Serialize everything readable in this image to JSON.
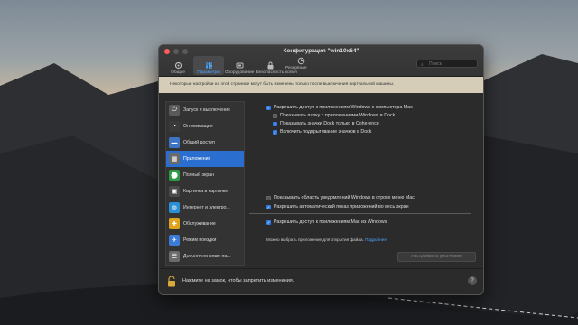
{
  "window": {
    "title": "Конфигурация \"win10x64\""
  },
  "toolbar": {
    "items": [
      {
        "label": "Общие",
        "icon": "gear-icon"
      },
      {
        "label": "Параметры",
        "icon": "sliders-icon"
      },
      {
        "label": "Оборудование",
        "icon": "hardware-icon"
      },
      {
        "label": "Безопасность",
        "icon": "lock-icon"
      },
      {
        "label": "Резервная копия",
        "icon": "clock-icon"
      }
    ],
    "active_index": 1,
    "search_placeholder": "Поиск"
  },
  "notice": "Некоторые настройки на этой странице могут быть изменены только после выключения виртуальной машины.",
  "sidebar": {
    "items": [
      {
        "label": "Запуск и выключение",
        "icon": "power-icon",
        "color": "#5a5a5c"
      },
      {
        "label": "Оптимизация",
        "icon": "speedometer-icon",
        "color": "#3a3a3c"
      },
      {
        "label": "Общий доступ",
        "icon": "folder-icon",
        "color": "#3d74c4"
      },
      {
        "label": "Приложения",
        "icon": "apps-icon",
        "color": "#6a6a6a"
      },
      {
        "label": "Полный экран",
        "icon": "fullscreen-icon",
        "color": "#2d9b45"
      },
      {
        "label": "Картинка в картинке",
        "icon": "pip-icon",
        "color": "#4a4a4c"
      },
      {
        "label": "Интернет и электро...",
        "icon": "globe-icon",
        "color": "#2b8fd6"
      },
      {
        "label": "Обслуживание",
        "icon": "maintenance-icon",
        "color": "#e0a21a"
      },
      {
        "label": "Режим поездки",
        "icon": "travel-icon",
        "color": "#3a7bd5"
      },
      {
        "label": "Дополнительные на...",
        "icon": "advanced-icon",
        "color": "#6a6a6c"
      }
    ],
    "active_index": 3
  },
  "options": [
    {
      "label": "Разрешить доступ к приложениям Windows с компьютера Mac",
      "checked": true,
      "indent": 0
    },
    {
      "label": "Показывать папку с приложениями Windows в Dock",
      "checked": false,
      "indent": 1
    },
    {
      "label": "Показывать значки Dock только в Coherence",
      "checked": true,
      "indent": 1
    },
    {
      "label": "Включить подпрыгивание значков в Dock",
      "checked": true,
      "indent": 1
    },
    {
      "label": "Показывать область уведомлений Windows в строке меню Mac",
      "checked": false,
      "indent": 0
    },
    {
      "label": "Разрешить автоматический показ приложений во весь экран",
      "checked": true,
      "indent": 0
    },
    {
      "label": "Разрешить доступ к приложениям Mac из Windows",
      "checked": true,
      "indent": 0
    }
  ],
  "note": {
    "text": "Можно выбрать приложение для открытия файла.",
    "link": "Подробнее"
  },
  "default_button": "Настройки по умолчанию",
  "lock_text": "Нажмите на замок, чтобы запретить изменения.",
  "help_label": "?",
  "colors": {
    "accent": "#2a6ed0",
    "link": "#4aa8ff",
    "notice_bg": "#d5cdb8"
  }
}
